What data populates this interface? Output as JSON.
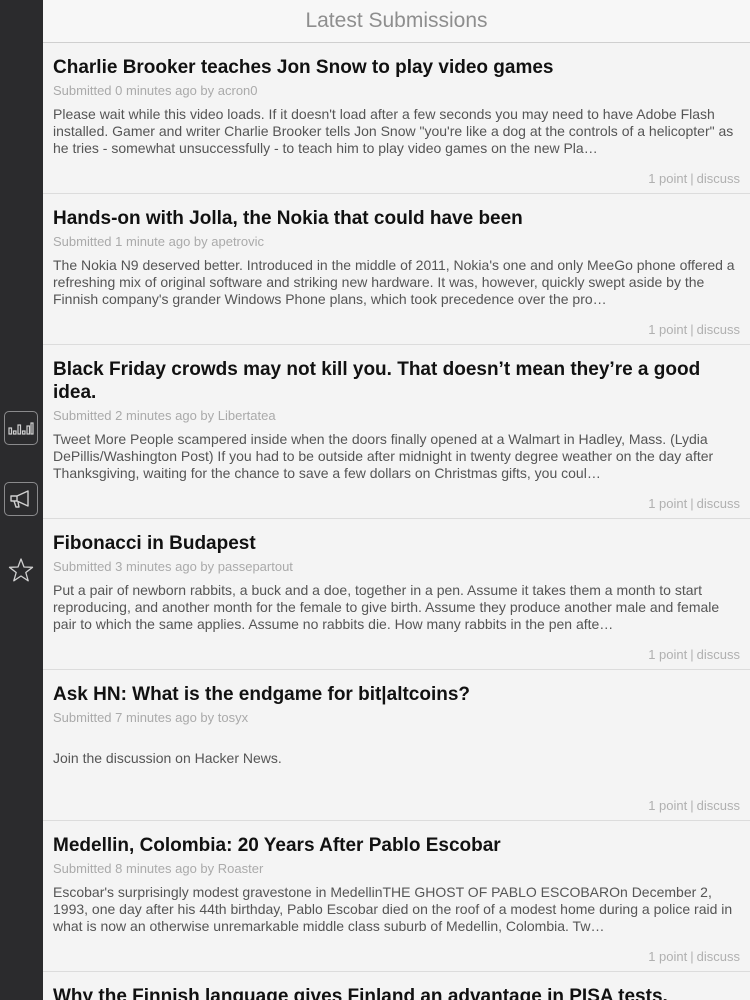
{
  "header": {
    "title": "Latest Submissions"
  },
  "sidebar": {
    "items": [
      {
        "name": "stats",
        "icon": "bar-chart-icon"
      },
      {
        "name": "announce",
        "icon": "megaphone-icon"
      },
      {
        "name": "favorites",
        "icon": "star-icon"
      }
    ]
  },
  "stories": [
    {
      "title": "Charlie Brooker teaches Jon Snow to play video games",
      "meta": "Submitted 0 minutes ago by acron0",
      "desc": "Please wait while this video loads. If it doesn't load after a few seconds you may need to have Adobe Flash installed. Gamer and writer Charlie Brooker tells Jon Snow \"you're like a dog at the controls of a helicopter\" as he tries - somewhat unsuccessfully - to teach him to play video games on the new Pla…",
      "points": "1 point",
      "discuss": "discuss"
    },
    {
      "title": "Hands-on with Jolla, the Nokia that could have been",
      "meta": "Submitted 1 minute ago by apetrovic",
      "desc": "The Nokia N9 deserved better. Introduced in the middle of 2011, Nokia's one and only MeeGo phone offered a refreshing mix of original software and striking new hardware. It was, however, quickly swept aside by the Finnish company's grander Windows Phone plans, which took precedence over the pro…",
      "points": "1 point",
      "discuss": "discuss"
    },
    {
      "title": "Black Friday crowds may not kill you. That doesn’t mean they’re a good idea.",
      "meta": "Submitted 2 minutes ago by Libertatea",
      "desc": "Tweet More People scampered inside when the doors finally opened at a Walmart in Hadley, Mass. (Lydia DePillis/Washington Post) If you had to be outside after midnight in twenty degree weather on the day after Thanksgiving, waiting for the chance to save a few dollars on Christmas gifts, you coul…",
      "points": "1 point",
      "discuss": "discuss"
    },
    {
      "title": "Fibonacci in Budapest",
      "meta": "Submitted 3 minutes ago by passepartout",
      "desc": "Put a pair of newborn rabbits, a buck and a doe, together in a pen. Assume it takes them a month to start reproducing, and another month for the female to give birth. Assume they produce another male and female pair to which the same applies. Assume no rabbits die. How many rabbits in the pen afte…",
      "points": "1 point",
      "discuss": "discuss"
    },
    {
      "title": "Ask HN: What is the endgame for bit|altcoins?",
      "meta": "Submitted 7 minutes ago by tosyx",
      "desc": "Join the discussion on Hacker News.",
      "points": "1 point",
      "discuss": "discuss"
    },
    {
      "title": "Medellin, Colombia: 20 Years After Pablo Escobar",
      "meta": "Submitted 8 minutes ago by Roaster",
      "desc": "Escobar's surprisingly modest gravestone in MedellinTHE GHOST OF PABLO ESCOBAROn December 2, 1993, one day after his 44th birthday, Pablo Escobar died on the roof of a modest home during a police raid in what is now an otherwise unremarkable middle class suburb of Medellin, Colombia. Tw…",
      "points": "1 point",
      "discuss": "discuss"
    },
    {
      "title": "Why the Finnish language gives Finland an advantage in PISA tests."
    }
  ]
}
